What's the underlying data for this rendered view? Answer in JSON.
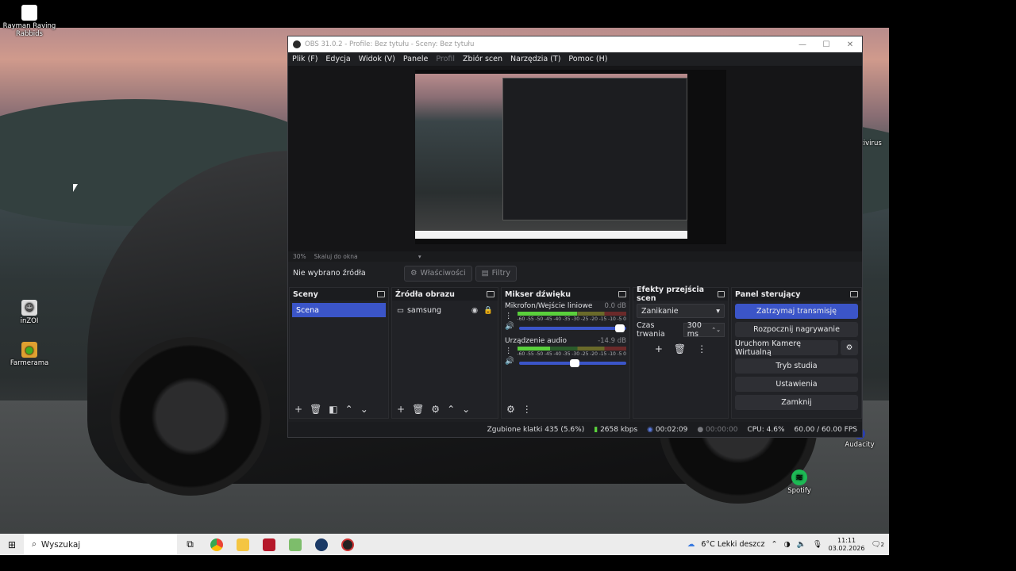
{
  "desktop": {
    "icons": [
      {
        "label": "Rayman Raving Rabbids"
      },
      {
        "label": "inZOI"
      },
      {
        "label": "Farmerama"
      },
      {
        "label": "Antivirus"
      },
      {
        "label": "Audacity"
      },
      {
        "label": "Spotify"
      }
    ]
  },
  "obs": {
    "title": "OBS 31.0.2 - Profile: Bez tytułu - Sceny: Bez tytułu",
    "menu": [
      "Plik (F)",
      "Edycja",
      "Widok (V)",
      "Panele",
      "Profil",
      "Zbiór scen",
      "Narzędzia (T)",
      "Pomoc (H)"
    ],
    "zoom": "30%",
    "scale_mode": "Skaluj do okna",
    "no_source": "Nie wybrano źródła",
    "properties_label": "Właściwości",
    "filters_label": "Filtry",
    "docks": {
      "scenes": {
        "title": "Sceny",
        "items": [
          "Scena"
        ]
      },
      "sources": {
        "title": "Źródła obrazu",
        "items": [
          "samsung"
        ]
      },
      "mixer": {
        "title": "Mikser dźwięku",
        "channels": [
          {
            "name": "Mikrofon/Wejście liniowe",
            "db": "0.0 dB",
            "level": 0.55,
            "volume": 0.97
          },
          {
            "name": "Urządzenie audio",
            "db": "-14.9 dB",
            "level": 0.3,
            "volume": 0.55
          }
        ],
        "ticks": [
          "-60",
          "-55",
          "-50",
          "-45",
          "-40",
          "-35",
          "-30",
          "-25",
          "-20",
          "-15",
          "-10",
          "-5",
          "0"
        ]
      },
      "transitions": {
        "title": "Efekty przejścia scen",
        "selected": "Zanikanie",
        "duration_label": "Czas trwania",
        "duration": "300 ms"
      },
      "controls": {
        "title": "Panel sterujący",
        "stop_stream": "Zatrzymaj transmisję",
        "start_recording": "Rozpocznij nagrywanie",
        "virtual_cam": "Uruchom Kamerę Wirtualną",
        "studio_mode": "Tryb studia",
        "settings": "Ustawienia",
        "exit": "Zamknij"
      }
    },
    "status": {
      "dropped": "Zgubione klatki 435 (5.6%)",
      "bitrate": "2658 kbps",
      "stream_time": "00:02:09",
      "rec_time": "00:00:00",
      "cpu": "CPU: 4.6%",
      "fps": "60.00 / 60.00 FPS"
    }
  },
  "taskbar": {
    "search_placeholder": "Wyszukaj",
    "weather": "6°C  Lekki deszcz",
    "time": "11:11",
    "date": "03.02.2026",
    "notifications": "2"
  }
}
